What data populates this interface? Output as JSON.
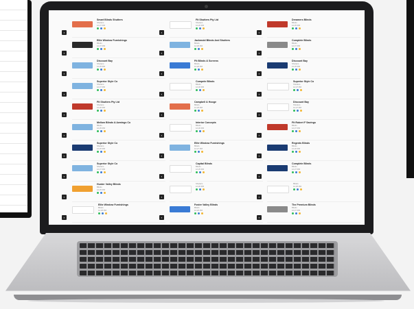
{
  "listings": [
    {
      "name": "Smart Blinds Shutters",
      "meta1": "Shutters",
      "time": "12:27 PM"
    },
    {
      "name": "Fit Shutters Pty Ltd",
      "meta1": "Shutters",
      "time": "12:26 PM"
    },
    {
      "name": "Dreamers Blinds",
      "meta1": "Blinds",
      "time": "12:25 PM"
    },
    {
      "name": "Elite Window Furnishings",
      "meta1": "Blinds",
      "time": "12:27 PM"
    },
    {
      "name": "Jackmoid Blinds And Shutters",
      "meta1": "Blinds",
      "time": "12:25 PM"
    },
    {
      "name": "Complete Blinds",
      "meta1": "Blinds",
      "time": "12:27 PM"
    },
    {
      "name": "Discount Bay",
      "meta1": "Shutters",
      "time": "12:25 PM"
    },
    {
      "name": "Fit Blinds & Screens",
      "meta1": "Blinds",
      "time": "12:26 PM"
    },
    {
      "name": "Discount Bay",
      "meta1": "Shutters",
      "time": "12:25 PM"
    },
    {
      "name": "Superior Style Co",
      "meta1": "Shutters",
      "time": "12:27 PM"
    },
    {
      "name": "Compete Blinds",
      "meta1": "Blinds",
      "time": "12:26 PM"
    },
    {
      "name": "Superior Style Co",
      "meta1": "Shutters",
      "time": "12:27 PM"
    },
    {
      "name": "Fit Shutters Pty Ltd",
      "meta1": "Shutters",
      "time": "12:26 PM"
    },
    {
      "name": "Campbell & Hooge",
      "meta1": "Blinds",
      "time": "12:25 PM"
    },
    {
      "name": "Discount Bay",
      "meta1": "Shutters",
      "time": "12:27 PM"
    },
    {
      "name": "Mellow Blinds & Awnings Co",
      "meta1": "Blinds",
      "time": "12:25 PM"
    },
    {
      "name": "Interior Concepts",
      "meta1": "Blinds",
      "time": "12:26 PM"
    },
    {
      "name": "Fit Robert F Savings",
      "meta1": "Blinds",
      "time": "12:27 PM"
    },
    {
      "name": "Superior Style Co",
      "meta1": "Shutters",
      "time": "12:25 PM"
    },
    {
      "name": "Elite Window Furnishings",
      "meta1": "Blinds",
      "time": "12:27 PM"
    },
    {
      "name": "Regents Blinds",
      "meta1": "Blinds",
      "time": "12:26 PM"
    },
    {
      "name": "Superior Style Co",
      "meta1": "Shutters",
      "time": "12:27 PM"
    },
    {
      "name": "Capital Blinds",
      "meta1": "Blinds",
      "time": "12:25 PM"
    },
    {
      "name": "Complete Blinds",
      "meta1": "Blinds",
      "time": "12:27 PM"
    },
    {
      "name": "Hunter Valley Blinds",
      "meta1": "Blinds",
      "time": "12:25 PM"
    },
    {
      "name": "",
      "meta1": "Shutters",
      "time": "12:26 PM"
    },
    {
      "name": "",
      "meta1": "Blinds",
      "time": "12:25 PM"
    },
    {
      "name": "Elite Window Furnishings",
      "meta1": "Blinds",
      "time": "12:25 PM"
    },
    {
      "name": "Foster Valley Blinds",
      "meta1": "Blinds",
      "time": "12:26 PM"
    },
    {
      "name": "The Premium Blinds",
      "meta1": "Blinds",
      "time": "12:27 PM"
    }
  ],
  "colors": {
    "green": "#2ebd59",
    "blue": "#3a7bd5",
    "yellow": "#f2b632",
    "bezel": "#1c1c1e"
  }
}
